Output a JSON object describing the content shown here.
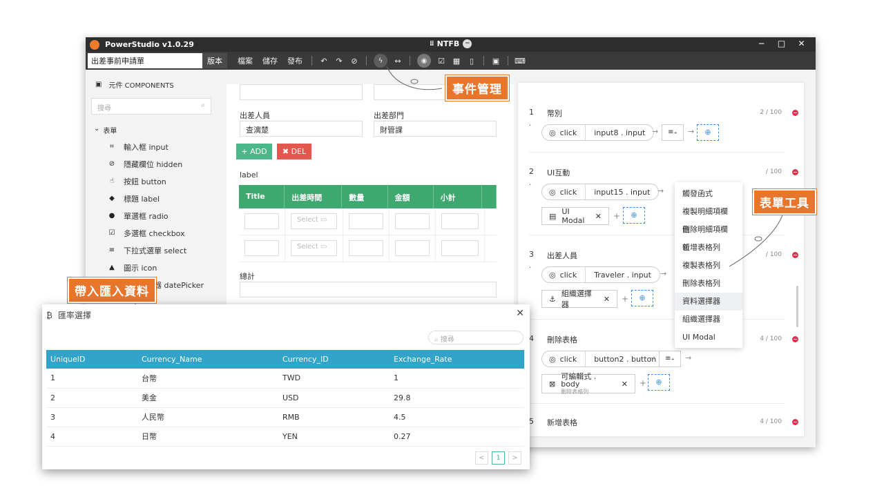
{
  "window": {
    "app_title": "PowerStudio v1.0.29",
    "center_title": "NTFB",
    "center_badge": "−",
    "min": "−",
    "max": "□",
    "close": "✕"
  },
  "toolbar": {
    "form_name": "出差事前申請單",
    "version_label": "版本",
    "menu": [
      "檔案",
      "儲存",
      "發布"
    ]
  },
  "sidebar": {
    "header": "元件 COMPONENTS",
    "search_placeholder": "搜尋",
    "group": "表單",
    "items": [
      {
        "label": "輸入框 input",
        "icon": "input-icon"
      },
      {
        "label": "隱藏欄位 hidden",
        "icon": "hidden-icon"
      },
      {
        "label": "按鈕 button",
        "icon": "button-icon"
      },
      {
        "label": "標題 label",
        "icon": "label-icon"
      },
      {
        "label": "單選框 radio",
        "icon": "radio-icon"
      },
      {
        "label": "多選框 checkbox",
        "icon": "checkbox-icon"
      },
      {
        "label": "下拉式選單 select",
        "icon": "select-icon"
      },
      {
        "label": "圖示 icon",
        "icon": "shapes-icon"
      },
      {
        "label": "日期選擇器 datePicker",
        "icon": "calendar-icon"
      }
    ]
  },
  "canvas": {
    "traveler_label": "出差人員",
    "traveler_value": "查漓楚",
    "dept_label": "出差部門",
    "dept_value": "財管課",
    "add_label": "+ ADD",
    "del_label": "✖ DEL",
    "grid_label": "label",
    "columns": [
      "Title",
      "出差時間",
      "數量",
      "金額",
      "小計"
    ],
    "select_placeholder": "Select",
    "total_label": "總計"
  },
  "events": [
    {
      "num": "1",
      "dot": ".",
      "title": "幣別",
      "count": "2 / 100",
      "trigger": "click",
      "target": "input8 . input"
    },
    {
      "num": "2",
      "dot": ".",
      "title": "UI互動",
      "count": "/ 100",
      "trigger": "click",
      "target": "input15 . input",
      "chip": "UI Modal"
    },
    {
      "num": "3",
      "dot": ".",
      "title": "出差人員",
      "count": "/ 100",
      "trigger": "click",
      "target": "Traveler . input",
      "chip": "組織選擇器"
    },
    {
      "num": "4",
      "dot": "",
      "title": "刪除表格",
      "count": "4 / 100",
      "trigger": "click",
      "target": "button2 . button",
      "chip": "可編輯式 . body",
      "chip_sub": "刪除表格列"
    },
    {
      "num": "5",
      "dot": "",
      "title": "新增表格",
      "count": "4 / 100"
    }
  ],
  "dropdown": [
    "觸發函式",
    "複製明細項欄位",
    "刪除明細項欄位",
    "新增表格列",
    "複製表格列",
    "刪除表格列",
    "資料選擇器",
    "組織選擇器",
    "UI Modal"
  ],
  "callouts": {
    "event_mgmt": "事件管理",
    "form_tools": "表單工具",
    "import_data": "帶入匯入資料"
  },
  "modal": {
    "title": "匯率選擇",
    "search_placeholder": "搜尋",
    "columns": [
      "UniqueID",
      "Currency_Name",
      "Currency_ID",
      "Exchange_Rate"
    ],
    "rows": [
      [
        "1",
        "台幣",
        "TWD",
        "1"
      ],
      [
        "2",
        "美金",
        "USD",
        "29.8"
      ],
      [
        "3",
        "人民幣",
        "RMB",
        "4.5"
      ],
      [
        "4",
        "日幣",
        "YEN",
        "0.27"
      ]
    ],
    "page": "1",
    "prev": "<",
    "next": ">"
  },
  "colors": {
    "accent_orange": "#e8752c",
    "grid_green": "#3ea86e",
    "table_blue": "#33a4c9"
  }
}
